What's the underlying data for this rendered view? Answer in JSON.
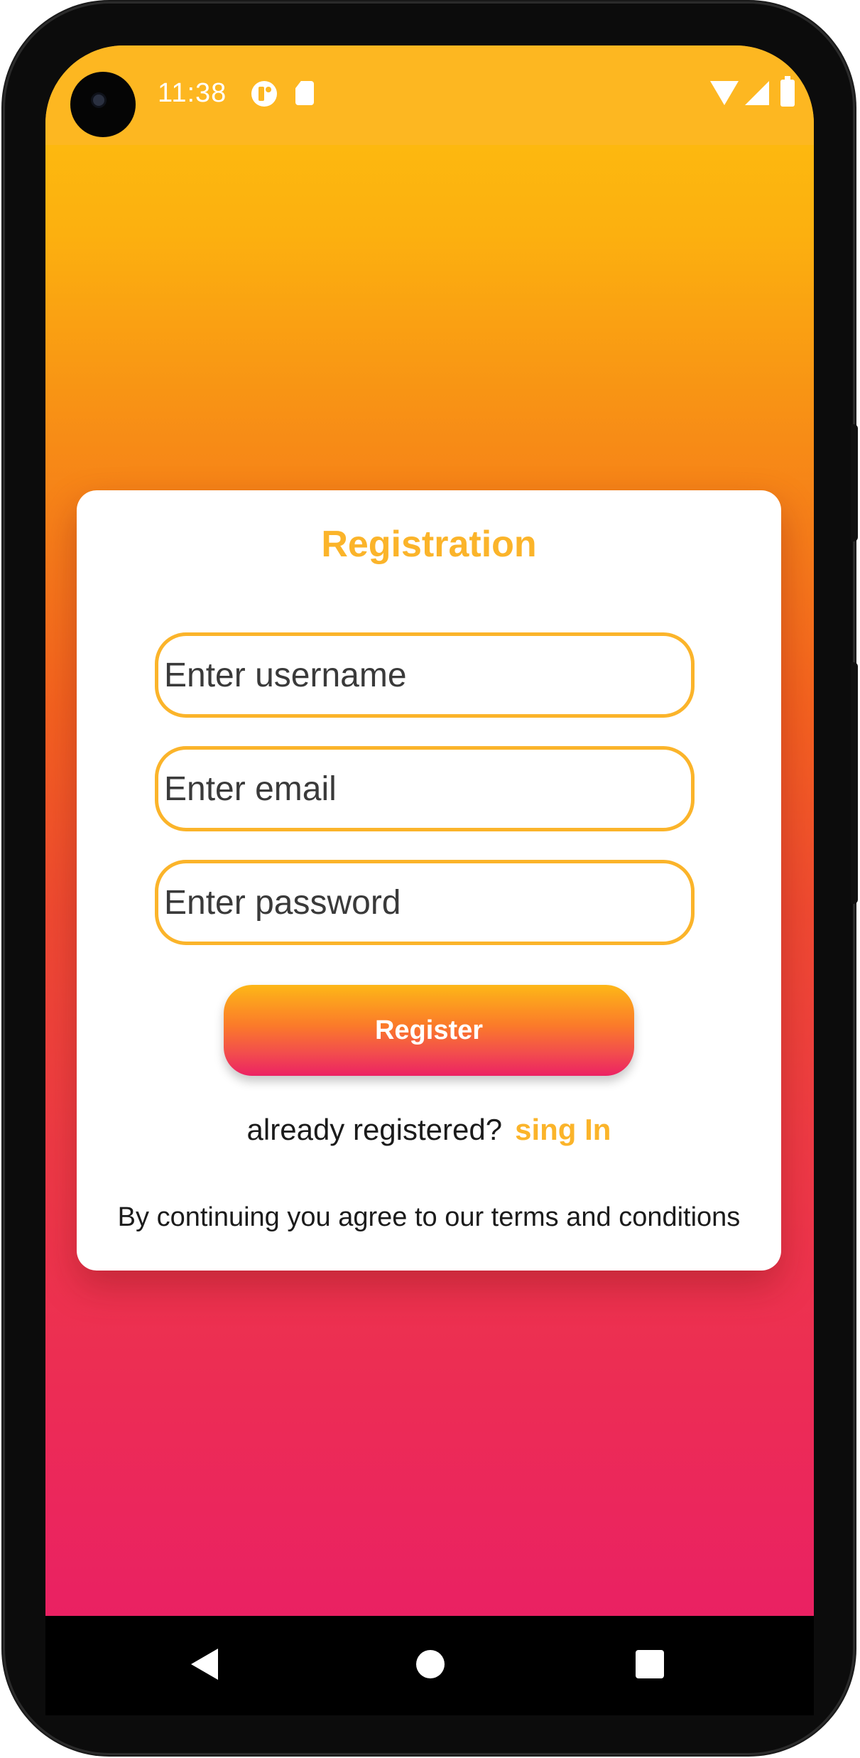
{
  "status_bar": {
    "time": "11:38",
    "icons": [
      "camera-cutout-icon",
      "app-notification-icon",
      "sd-card-icon",
      "wifi-icon",
      "cell-signal-icon",
      "battery-icon"
    ]
  },
  "registration": {
    "title": "Registration",
    "username_placeholder": "Enter username",
    "email_placeholder": "Enter email",
    "password_placeholder": "Enter password",
    "register_label": "Register",
    "already_registered_text": "already registered?",
    "sign_in_label": "sing In",
    "terms_text": "By continuing you agree to our terms and conditions"
  },
  "navigation": {
    "icons": [
      "back-icon",
      "home-icon",
      "recents-icon"
    ]
  },
  "colors": {
    "accent": "#fbb42a",
    "gradient_top": "#fec10f",
    "gradient_bottom": "#ea2163",
    "button_gradient_top": "#fdb717",
    "button_gradient_bottom": "#ec2263"
  }
}
